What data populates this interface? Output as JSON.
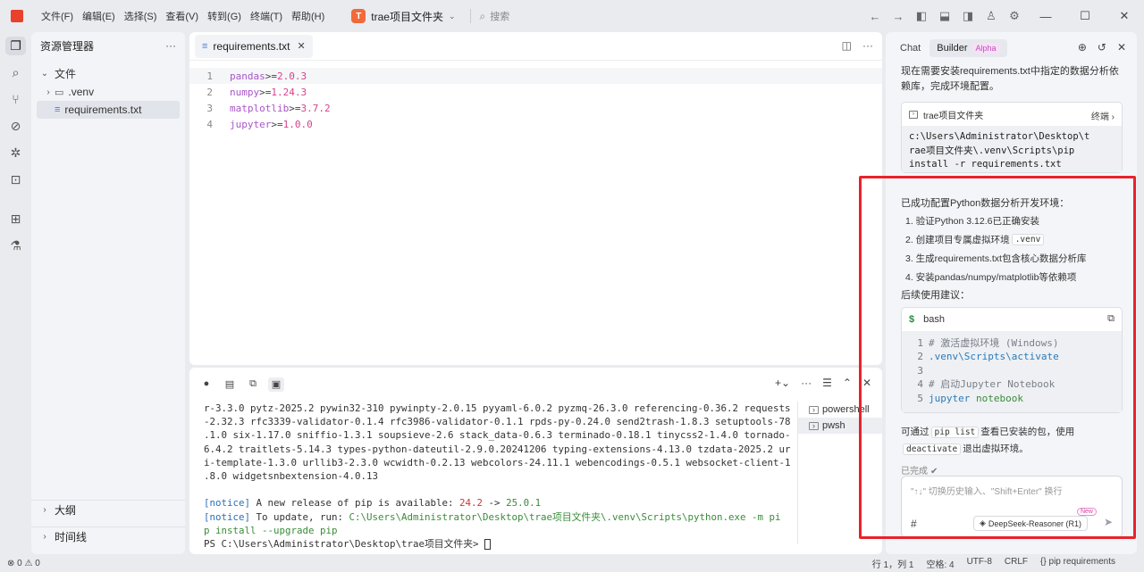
{
  "titlebar": {
    "menu": [
      "文件(F)",
      "编辑(E)",
      "选择(S)",
      "查看(V)",
      "转到(G)",
      "终端(T)",
      "帮助(H)"
    ],
    "project_badge": "T",
    "project_name": "trae项目文件夹",
    "search_placeholder": "搜索"
  },
  "explorer": {
    "title": "资源管理器",
    "more": "···",
    "section": "文件",
    "items": [
      {
        "label": ".venv",
        "type": "folder"
      },
      {
        "label": "requirements.txt",
        "type": "file"
      }
    ],
    "outline": "大纲",
    "timeline": "时间线"
  },
  "editor": {
    "tab_name": "requirements.txt",
    "lines": [
      {
        "num": "1",
        "pkg": "pandas",
        "op": ">=",
        "ver": "2.0.3"
      },
      {
        "num": "2",
        "pkg": "numpy",
        "op": ">=",
        "ver": "1.24.3"
      },
      {
        "num": "3",
        "pkg": "matplotlib",
        "op": ">=",
        "ver": "3.7.2"
      },
      {
        "num": "4",
        "pkg": "jupyter",
        "op": ">=",
        "ver": "1.0.0"
      }
    ]
  },
  "terminal": {
    "lines": [
      "r-3.3.0 pytz-2025.2 pywin32-310 pywinpty-2.0.15 pyyaml-6.0.2 pyzmq-26.3.0 referencing-0.36.2 requests",
      "-2.32.3 rfc3339-validator-0.1.4 rfc3986-validator-0.1.1 rpds-py-0.24.0 send2trash-1.8.3 setuptools-78",
      ".1.0 six-1.17.0 sniffio-1.3.1 soupsieve-2.6 stack_data-0.6.3 terminado-0.18.1 tinycss2-1.4.0 tornado-",
      "6.4.2 traitlets-5.14.3 types-python-dateutil-2.9.0.20241206 typing-extensions-4.13.0 tzdata-2025.2 ur",
      "i-template-1.3.0 urllib3-2.3.0 wcwidth-0.2.13 webcolors-24.11.1 webencodings-0.5.1 websocket-client-1",
      ".8.0 widgetsnbextension-4.0.13"
    ],
    "notice1_tag": "[notice]",
    "notice1_text": " A new release of pip is available: ",
    "notice1_old": "24.2",
    "notice1_arrow": " -> ",
    "notice1_new": "25.0.1",
    "notice2_tag": "[notice]",
    "notice2_text": " To update, run: ",
    "notice2_cmd_a": "C:\\Users\\Administrator\\Desktop\\trae项目文件夹\\.venv\\Scripts\\python.exe -m pi",
    "notice2_cmd_b": "p install --upgrade pip",
    "prompt": "PS C:\\Users\\Administrator\\Desktop\\trae项目文件夹> ",
    "sessions": [
      "powershell",
      "pwsh"
    ]
  },
  "chat": {
    "tabs": [
      "Chat",
      "Builder"
    ],
    "alpha": "Alpha",
    "intro": "现在需要安装requirements.txt中指定的数据分析依赖库，完成环境配置。",
    "cmd_card": {
      "folder": "trae项目文件夹",
      "action": "终端",
      "code": "c:\\Users\\Administrator\\Desktop\\t\nrae项目文件夹\\.venv\\Scripts\\pip\ninstall -r requirements.txt"
    },
    "result_title": "已成功配置Python数据分析开发环境：",
    "result_items": {
      "i1": "1. 验证Python 3.12.6已正确安装",
      "i2_pre": "2. 创建项目专属虚拟环境",
      "i2_code": ".venv",
      "i3": "3. 生成requirements.txt包含核心数据分析库",
      "i4": "4. 安装pandas/numpy/matplotlib等依赖项"
    },
    "advice_title": "后续使用建议：",
    "bash": {
      "dollar": "$",
      "lang": "bash",
      "lines": [
        {
          "n": "1",
          "comment": "# 激活虚拟环境 (Windows)"
        },
        {
          "n": "2",
          "path": ".venv\\Scripts\\activate"
        },
        {
          "n": "3"
        },
        {
          "n": "4",
          "comment": "# 启动Jupyter Notebook"
        },
        {
          "n": "5",
          "kw": "jupyter",
          "arg": "notebook"
        }
      ]
    },
    "tip_pre": "可通过",
    "tip_code1": "pip list",
    "tip_mid": "查看已安装的包，使用",
    "tip_code2": "deactivate",
    "tip_post": "退出虚拟环境。",
    "done": "已完成",
    "input_placeholder": "\"↑↓\" 切换历史输入、\"Shift+Enter\" 换行",
    "hash": "#",
    "model": "DeepSeek-Reasoner (R1)",
    "new_badge": "New"
  },
  "statusbar": {
    "problems": "0",
    "warnings": "0",
    "position": "行 1，列 1",
    "spaces": "空格: 4",
    "encoding": "UTF-8",
    "eol": "CRLF",
    "language": "{} pip requirements"
  }
}
